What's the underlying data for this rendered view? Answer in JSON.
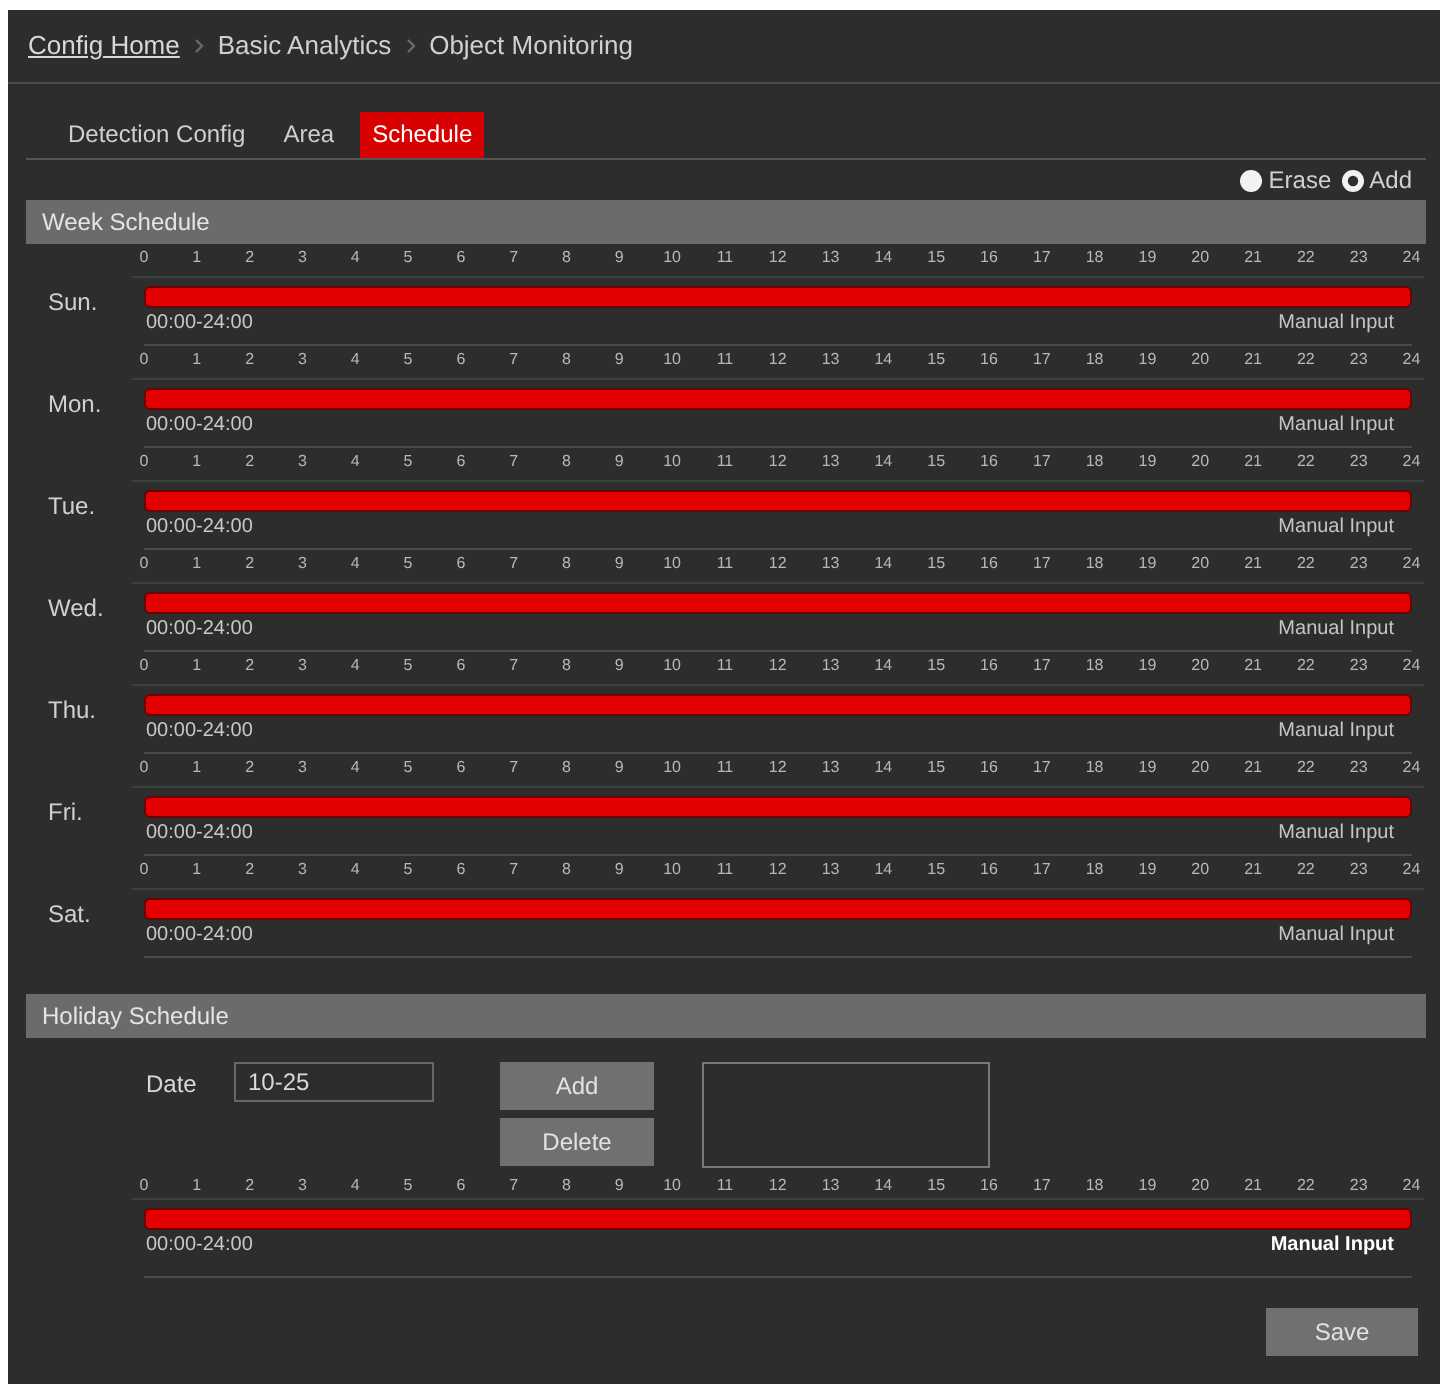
{
  "breadcrumb": [
    {
      "label": "Config Home",
      "kind": "link"
    },
    {
      "label": "Basic Analytics",
      "kind": "text"
    },
    {
      "label": "Object Monitoring",
      "kind": "text"
    }
  ],
  "tabs": [
    {
      "label": "Detection Config",
      "selected": false
    },
    {
      "label": "Area",
      "selected": false
    },
    {
      "label": "Schedule",
      "selected": true
    }
  ],
  "mode_options": [
    {
      "label": "Erase",
      "selected": false
    },
    {
      "label": "Add",
      "selected": true
    }
  ],
  "week_schedule": {
    "title": "Week Schedule",
    "days": [
      {
        "day": "Sun.",
        "ticks": [
          "0",
          "1",
          "2",
          "3",
          "4",
          "5",
          "6",
          "7",
          "8",
          "9",
          "10",
          "11",
          "12",
          "13",
          "14",
          "15",
          "16",
          "17",
          "18",
          "19",
          "20",
          "21",
          "22",
          "23",
          "24"
        ],
        "level": 1,
        "range": "00:00-24:00",
        "manual_input": {
          "label": "Manual Input",
          "highlighted": false
        }
      },
      {
        "day": "Mon.",
        "ticks": [
          "0",
          "1",
          "2",
          "3",
          "4",
          "5",
          "6",
          "7",
          "8",
          "9",
          "10",
          "11",
          "12",
          "13",
          "14",
          "15",
          "16",
          "17",
          "18",
          "19",
          "20",
          "21",
          "22",
          "23",
          "24"
        ],
        "level": 1,
        "range": "00:00-24:00",
        "manual_input": {
          "label": "Manual Input",
          "highlighted": false
        }
      },
      {
        "day": "Tue.",
        "ticks": [
          "0",
          "1",
          "2",
          "3",
          "4",
          "5",
          "6",
          "7",
          "8",
          "9",
          "10",
          "11",
          "12",
          "13",
          "14",
          "15",
          "16",
          "17",
          "18",
          "19",
          "20",
          "21",
          "22",
          "23",
          "24"
        ],
        "level": 1,
        "range": "00:00-24:00",
        "manual_input": {
          "label": "Manual Input",
          "highlighted": false
        }
      },
      {
        "day": "Wed.",
        "ticks": [
          "0",
          "1",
          "2",
          "3",
          "4",
          "5",
          "6",
          "7",
          "8",
          "9",
          "10",
          "11",
          "12",
          "13",
          "14",
          "15",
          "16",
          "17",
          "18",
          "19",
          "20",
          "21",
          "22",
          "23",
          "24"
        ],
        "level": 1,
        "range": "00:00-24:00",
        "manual_input": {
          "label": "Manual Input",
          "highlighted": false
        }
      },
      {
        "day": "Thu.",
        "ticks": [
          "0",
          "1",
          "2",
          "3",
          "4",
          "5",
          "6",
          "7",
          "8",
          "9",
          "10",
          "11",
          "12",
          "13",
          "14",
          "15",
          "16",
          "17",
          "18",
          "19",
          "20",
          "21",
          "22",
          "23",
          "24"
        ],
        "level": 1,
        "range": "00:00-24:00",
        "manual_input": {
          "label": "Manual Input",
          "highlighted": false
        }
      },
      {
        "day": "Fri.",
        "ticks": [
          "0",
          "1",
          "2",
          "3",
          "4",
          "5",
          "6",
          "7",
          "8",
          "9",
          "10",
          "11",
          "12",
          "13",
          "14",
          "15",
          "16",
          "17",
          "18",
          "19",
          "20",
          "21",
          "22",
          "23",
          "24"
        ],
        "level": 1,
        "range": "00:00-24:00",
        "manual_input": {
          "label": "Manual Input",
          "highlighted": false
        }
      },
      {
        "day": "Sat.",
        "ticks": [
          "0",
          "1",
          "2",
          "3",
          "4",
          "5",
          "6",
          "7",
          "8",
          "9",
          "10",
          "11",
          "12",
          "13",
          "14",
          "15",
          "16",
          "17",
          "18",
          "19",
          "20",
          "21",
          "22",
          "23",
          "24"
        ],
        "level": 1,
        "range": "00:00-24:00",
        "manual_input": {
          "label": "Manual Input",
          "highlighted": false
        }
      }
    ]
  },
  "holiday_schedule": {
    "title": "Holiday Schedule",
    "date_label": "Date",
    "date_value": "10-25",
    "buttons": [
      "Add",
      "Delete"
    ],
    "timeline": {
      "ticks": [
        "0",
        "1",
        "2",
        "3",
        "4",
        "5",
        "6",
        "7",
        "8",
        "9",
        "10",
        "11",
        "12",
        "13",
        "14",
        "15",
        "16",
        "17",
        "18",
        "19",
        "20",
        "21",
        "22",
        "23",
        "24"
      ],
      "level": 1,
      "range": "00:00-24:00",
      "manual_input": {
        "label": "Manual Input",
        "highlighted": true
      }
    }
  },
  "save_button": "Save"
}
